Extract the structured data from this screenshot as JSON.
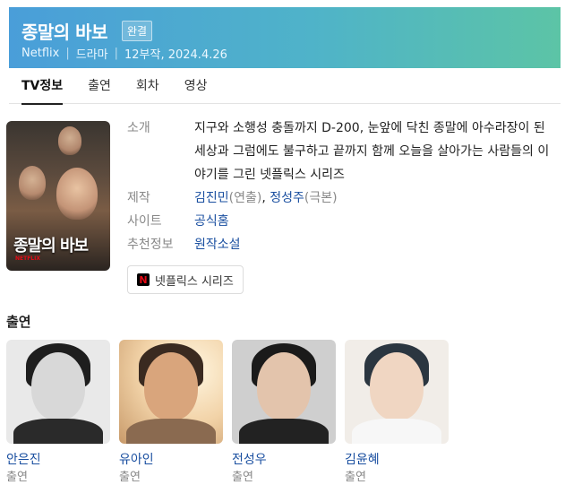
{
  "header": {
    "title": "종말의 바보",
    "badge": "완결",
    "meta": [
      "Netflix",
      "드라마",
      "12부작, 2024.4.26"
    ]
  },
  "tabs": [
    {
      "label": "TV정보",
      "active": true
    },
    {
      "label": "출연",
      "active": false
    },
    {
      "label": "회차",
      "active": false
    },
    {
      "label": "영상",
      "active": false
    }
  ],
  "poster": {
    "title": "종말의 바보",
    "brand": "NETFLIX"
  },
  "info": {
    "summary_label": "소개",
    "summary": "지구와 소행성 충돌까지 D-200, 눈앞에 닥친 종말에 아수라장이 된 세상과 그럼에도 불구하고 끝까지 함께 오늘을 살아가는 사람들의 이야기를 그린 넷플릭스 시리즈",
    "production_label": "제작",
    "director": "김진민",
    "director_role": "(연출)",
    "writer": "정성주",
    "writer_role": "(극본)",
    "separator": ", ",
    "site_label": "사이트",
    "site": "공식홈",
    "recommend_label": "추천정보",
    "recommend": "원작소설"
  },
  "netflix_button": {
    "icon_letter": "N",
    "label": "넷플릭스 시리즈"
  },
  "cast": {
    "heading": "출연",
    "members": [
      {
        "name": "안은진",
        "role": "출연"
      },
      {
        "name": "유아인",
        "role": "출연"
      },
      {
        "name": "전성우",
        "role": "출연"
      },
      {
        "name": "김윤혜",
        "role": "출연"
      }
    ]
  },
  "colors": {
    "banner_start": "#4a9ed9",
    "banner_end": "#5cc4a6",
    "link": "#1a4fa0",
    "netflix_red": "#e50914"
  }
}
